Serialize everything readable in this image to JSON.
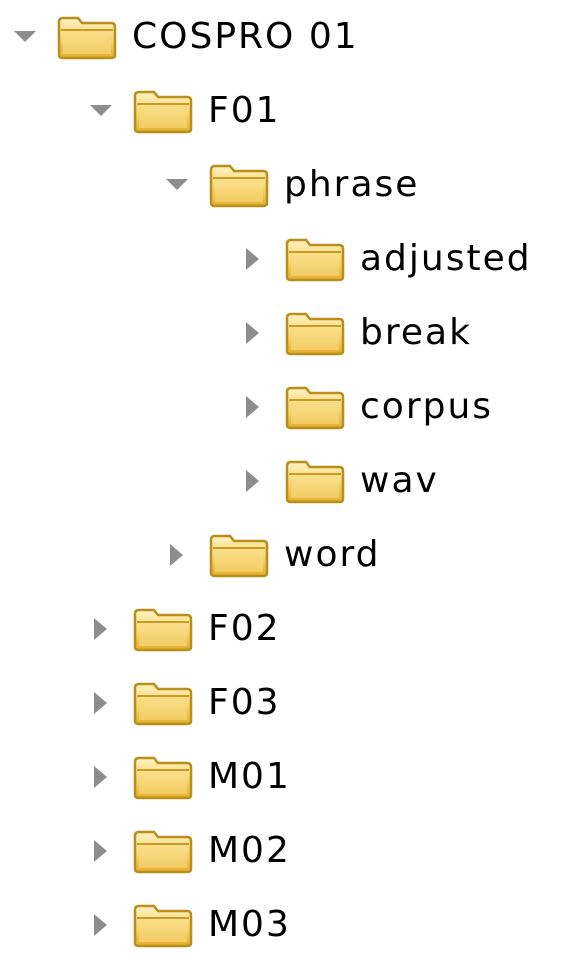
{
  "tree": {
    "items": [
      {
        "label": "COSPRO 01",
        "expanded": true,
        "depth": 0,
        "icon": "folder-icon"
      },
      {
        "label": "F01",
        "expanded": true,
        "depth": 1,
        "icon": "folder-icon"
      },
      {
        "label": "phrase",
        "expanded": true,
        "depth": 2,
        "icon": "folder-icon"
      },
      {
        "label": "adjusted",
        "expanded": false,
        "depth": 3,
        "icon": "folder-icon"
      },
      {
        "label": "break",
        "expanded": false,
        "depth": 3,
        "icon": "folder-icon"
      },
      {
        "label": "corpus",
        "expanded": false,
        "depth": 3,
        "icon": "folder-icon"
      },
      {
        "label": "wav",
        "expanded": false,
        "depth": 3,
        "icon": "folder-icon"
      },
      {
        "label": "word",
        "expanded": false,
        "depth": 2,
        "icon": "folder-icon"
      },
      {
        "label": "F02",
        "expanded": false,
        "depth": 1,
        "icon": "folder-icon"
      },
      {
        "label": "F03",
        "expanded": false,
        "depth": 1,
        "icon": "folder-icon"
      },
      {
        "label": "M01",
        "expanded": false,
        "depth": 1,
        "icon": "folder-icon"
      },
      {
        "label": "M02",
        "expanded": false,
        "depth": 1,
        "icon": "folder-icon"
      },
      {
        "label": "M03",
        "expanded": false,
        "depth": 1,
        "icon": "folder-icon"
      }
    ]
  },
  "colors": {
    "background": "#ffffff",
    "arrow": "#8d8d8d",
    "folder_fill": "#f6d46e",
    "folder_outline": "#b98e1a",
    "text": "#000000"
  }
}
